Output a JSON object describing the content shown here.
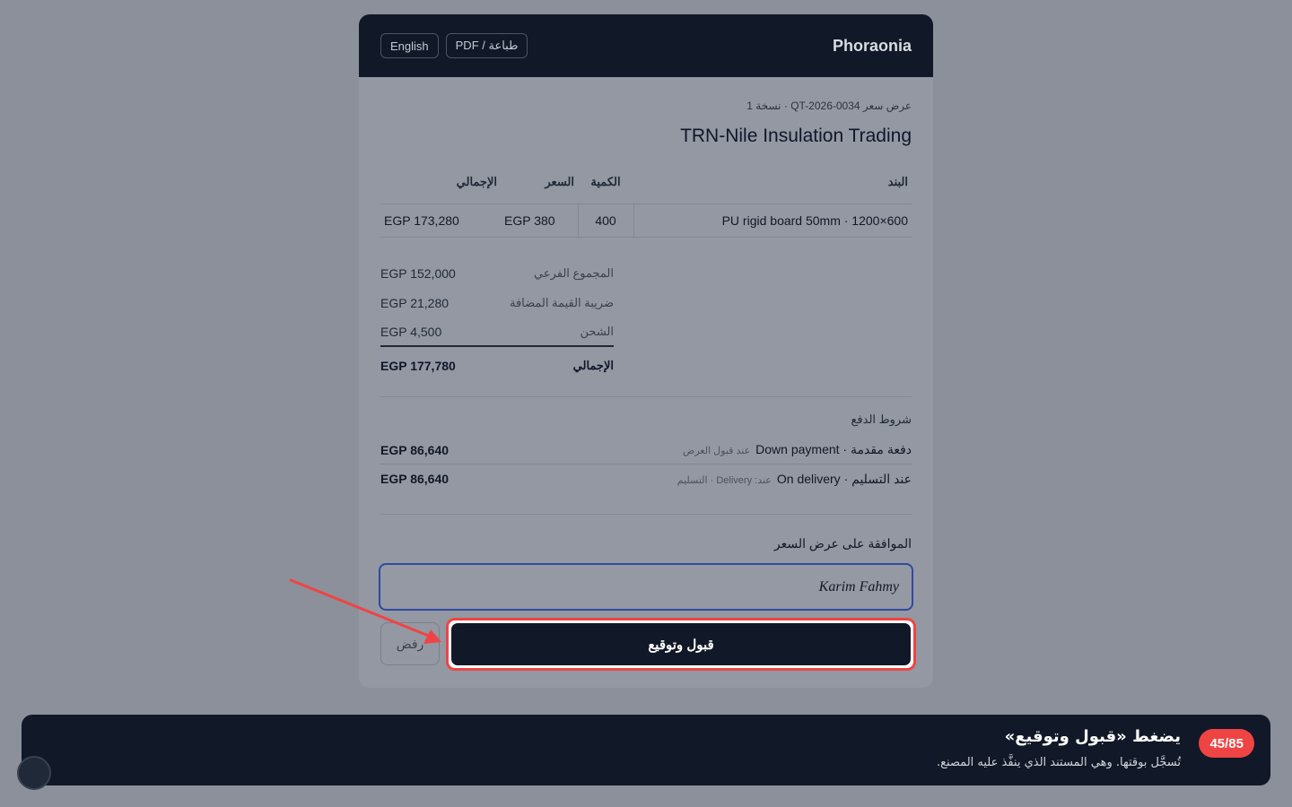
{
  "header": {
    "brand": "Phoraonia",
    "print_label": "PDF / طباعة",
    "lang_label": "English"
  },
  "quote": {
    "meta": "عرض سعر QT-2026-0034 · نسخة 1",
    "client": "TRN-Nile Insulation Trading"
  },
  "items": {
    "headers": [
      "البند",
      "الكمية",
      "السعر",
      "الإجمالي"
    ],
    "rows": [
      {
        "item": "PU rigid board 50mm · 1200×600",
        "qty": "400",
        "price": "EGP 380",
        "total": "EGP 173,280"
      }
    ]
  },
  "totals": {
    "subtotal_label": "المجموع الفرعي",
    "subtotal": "EGP 152,000",
    "vat_label": "ضريبة القيمة المضافة",
    "vat": "EGP 21,280",
    "shipping_label": "الشحن",
    "shipping": "EGP 4,500",
    "grand_label": "الإجمالي",
    "grand": "EGP 177,780"
  },
  "payment": {
    "title": "شروط الدفع",
    "rows": [
      {
        "desc": "دفعة مقدمة · Down payment",
        "note": "عند قبول العرض",
        "amount": "EGP 86,640"
      },
      {
        "desc": "عند التسليم · On delivery",
        "note": "عند: Delivery · التسليم",
        "amount": "EGP 86,640"
      }
    ]
  },
  "acceptance": {
    "title": "الموافقة على عرض السعر",
    "signature_value": "Karim Fahmy",
    "accept_label": "قبول وتوقيع",
    "reject_label": "رفض"
  },
  "tour": {
    "step": "45/85",
    "title": "يضغط «قبول وتوقيع»",
    "body": "تُسجَّل بوقتها. وهي المستند الذي ينفَّذ عليه المصنع."
  },
  "colors": {
    "dark": "#111827",
    "accent_red": "#ef4444",
    "focus_blue": "#2f4aa0"
  }
}
